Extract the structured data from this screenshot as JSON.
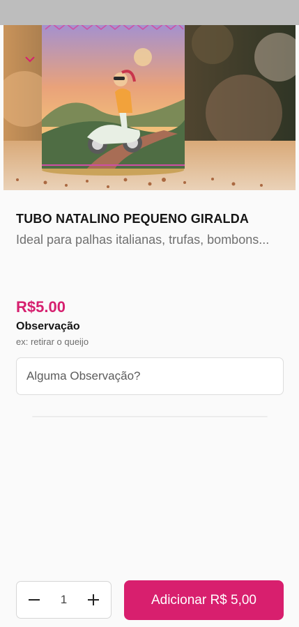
{
  "header": {
    "back_icon": "chevron-down-icon"
  },
  "product": {
    "image_alt": "TUBO NATALINO PEQUENO GIRALDA",
    "title": "TUBO NATALINO PEQUENO GIRALDA",
    "description": "Ideal para palhas italianas, trufas, bombons...",
    "price": "R$5.00"
  },
  "observation": {
    "title": "Observação",
    "hint": "ex: retirar o queijo",
    "placeholder": "Alguma Observação?",
    "value": ""
  },
  "footer": {
    "quantity": "1",
    "minus_icon": "minus-icon",
    "plus_icon": "plus-icon",
    "add_label": "Adicionar R$ 5,00"
  },
  "colors": {
    "accent": "#d81f6e",
    "price": "#d6206f"
  }
}
